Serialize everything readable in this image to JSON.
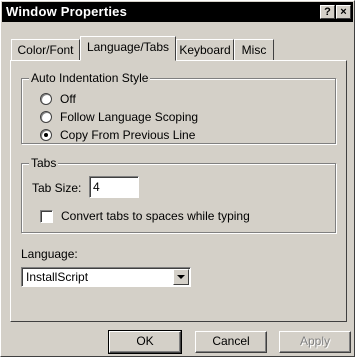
{
  "window": {
    "title": "Window Properties",
    "help_button": "?",
    "close_button": "×"
  },
  "tabs": [
    {
      "label": "Color/Font",
      "active": false
    },
    {
      "label": "Language/Tabs",
      "active": true
    },
    {
      "label": "Keyboard",
      "active": false
    },
    {
      "label": "Misc",
      "active": false
    }
  ],
  "auto_indentation": {
    "legend": "Auto Indentation Style",
    "options": [
      {
        "label": "Off",
        "selected": false
      },
      {
        "label": "Follow Language Scoping",
        "selected": false
      },
      {
        "label": "Copy From Previous Line",
        "selected": true
      }
    ]
  },
  "tabs_group": {
    "legend": "Tabs",
    "tab_size_label": "Tab Size:",
    "tab_size_value": "4",
    "convert_label": "Convert tabs to spaces while typing",
    "convert_checked": false
  },
  "language": {
    "label": "Language:",
    "selected": "InstallScript"
  },
  "buttons": {
    "ok": "OK",
    "cancel": "Cancel",
    "apply": "Apply"
  }
}
